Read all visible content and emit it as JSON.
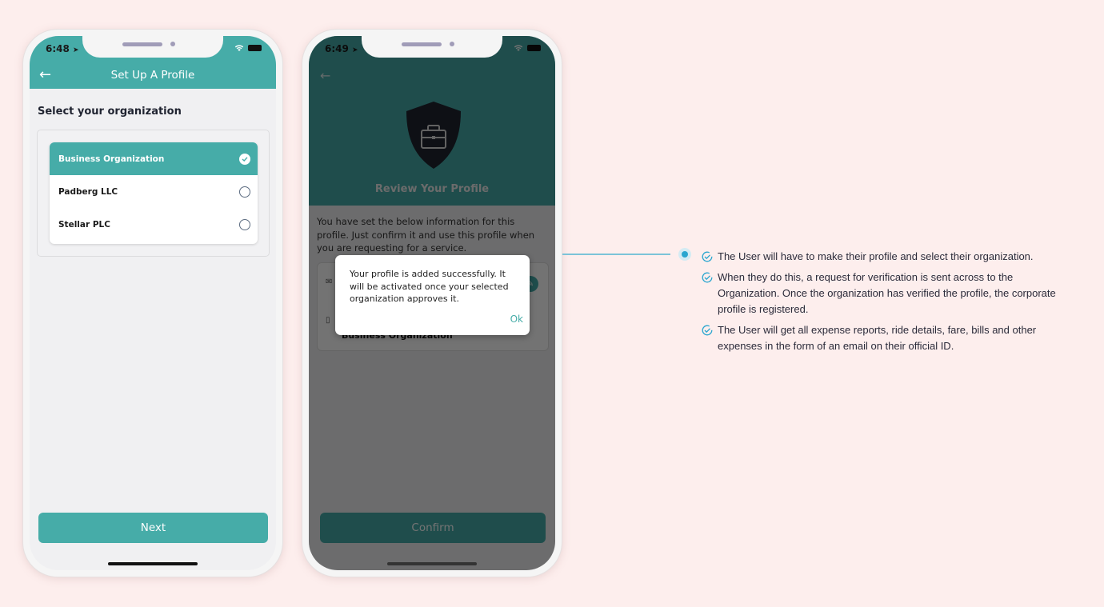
{
  "phone1": {
    "status_time": "6:48",
    "header_title": "Set Up A Profile",
    "section_title": "Select your organization",
    "organizations": [
      {
        "label": "Business Organization",
        "selected": true
      },
      {
        "label": "Padberg LLC",
        "selected": false
      },
      {
        "label": "Stellar PLC",
        "selected": false
      }
    ],
    "next_label": "Next"
  },
  "phone2": {
    "status_time": "6:49",
    "review_title": "Review Your Profile",
    "description": "You have set the below information for this profile. Just confirm it and use this profile when you are requesting for a service.",
    "card_org_value": "Business Organization",
    "confirm_label": "Confirm",
    "dialog": {
      "message": "Your profile is added successfully. It will be activated once your selected organization approves it.",
      "ok_label": "Ok"
    }
  },
  "bullets": [
    "The User will have to make their profile and select their organization.",
    "When they do this, a request for verification is sent across to the Organization. Once the organization has verified the profile, the corporate profile is registered.",
    "The User will get all expense reports, ride details, fare, bills and other expenses in the form of an email on their official ID."
  ],
  "colors": {
    "accent": "#46aca8",
    "background": "#fdeeed",
    "bullet_check": "#2aa6cf"
  }
}
